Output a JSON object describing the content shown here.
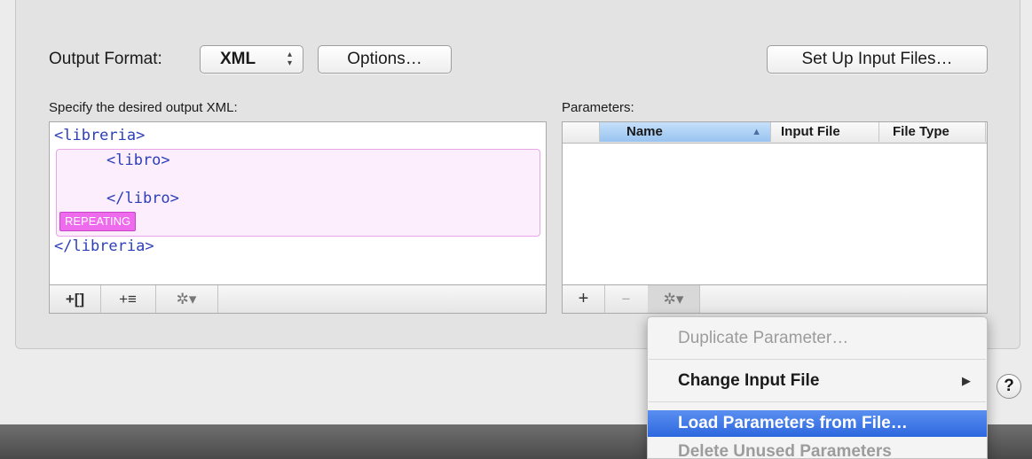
{
  "toolbar": {
    "output_format_label": "Output Format:",
    "format_select_value": "XML",
    "options_button": "Options…",
    "setup_button": "Set Up Input Files…"
  },
  "xml_panel": {
    "title": "Specify the desired output XML:",
    "lines": [
      "<libreria>",
      "<libro>",
      "</libro>",
      "</libreria>"
    ],
    "repeating_badge": "REPEATING",
    "bar": {
      "add_element": "+[]",
      "add_list": "+≡",
      "gear": "✲▾"
    }
  },
  "params_panel": {
    "title": "Parameters:",
    "columns": [
      "Name",
      "Input File",
      "File Type"
    ],
    "sort_indicator": "▲",
    "bar": {
      "add": "+",
      "remove": "−",
      "gear": "✲▾"
    }
  },
  "context_menu": {
    "items": [
      {
        "label": "Duplicate Parameter…",
        "enabled": false
      },
      {
        "label": "Change Input File",
        "enabled": true,
        "submenu_arrow": "▶"
      },
      {
        "label": "Load Parameters from File…",
        "enabled": true,
        "highlighted": true
      },
      {
        "label": "Delete Unused Parameters",
        "enabled": false
      }
    ]
  },
  "help_button": "?",
  "colors": {
    "xml_tag": "#2b3fb8",
    "repeating_bg": "#fdeefd",
    "badge": "#ee6bee",
    "menu_highlight": "#3d78e6",
    "header_selected": "#a9cdf4"
  }
}
